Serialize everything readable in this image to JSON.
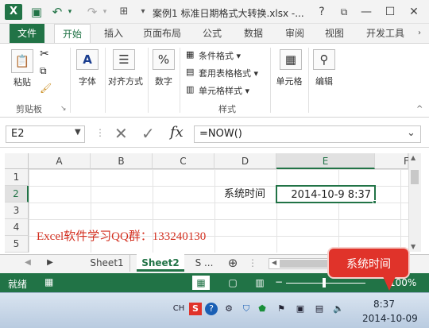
{
  "titlebar": {
    "logo": "X",
    "doc_title": "案例1 标准日期格式大转换.xlsx -...",
    "help": "?",
    "restore": "⧉",
    "minimize": "—",
    "maximize": "☐",
    "close": "✕"
  },
  "tabs": [
    "文件",
    "开始",
    "插入",
    "页面布局",
    "公式",
    "数据",
    "审阅",
    "视图",
    "开发工具"
  ],
  "ribbon": {
    "paste": "粘贴",
    "clipboard": "剪贴板",
    "font": "字体",
    "align": "对齐方式",
    "number": "数字",
    "cond_format": "条件格式",
    "table_format": "套用表格格式",
    "cell_style": "单元格样式",
    "styles_group": "样式",
    "cells": "单元格",
    "edit": "编辑",
    "font_icon": "A",
    "number_icon": "%"
  },
  "formula_bar": {
    "name_box": "E2",
    "cancel": "✕",
    "enter": "✓",
    "fx": "fx",
    "formula": "=NOW()"
  },
  "columns": [
    "A",
    "B",
    "C",
    "D",
    "E",
    "F"
  ],
  "rows": [
    "1",
    "2",
    "3",
    "4",
    "5"
  ],
  "cells": {
    "d2": "系统时间",
    "e2": "2014-10-9 8:37",
    "banner": "Excel软件学习QQ群：133240130"
  },
  "sheets": [
    "Sheet1",
    "Sheet2",
    "S ..."
  ],
  "status": {
    "ready": "就绪",
    "zoom": "100%"
  },
  "taskbar": {
    "lang": "CH",
    "time": "8:37",
    "date": "2014-10-09"
  },
  "callout": "系统时间",
  "colors": {
    "excel_green": "#217346",
    "callout_red": "#e0332a",
    "banner_red": "#d32f1f"
  }
}
